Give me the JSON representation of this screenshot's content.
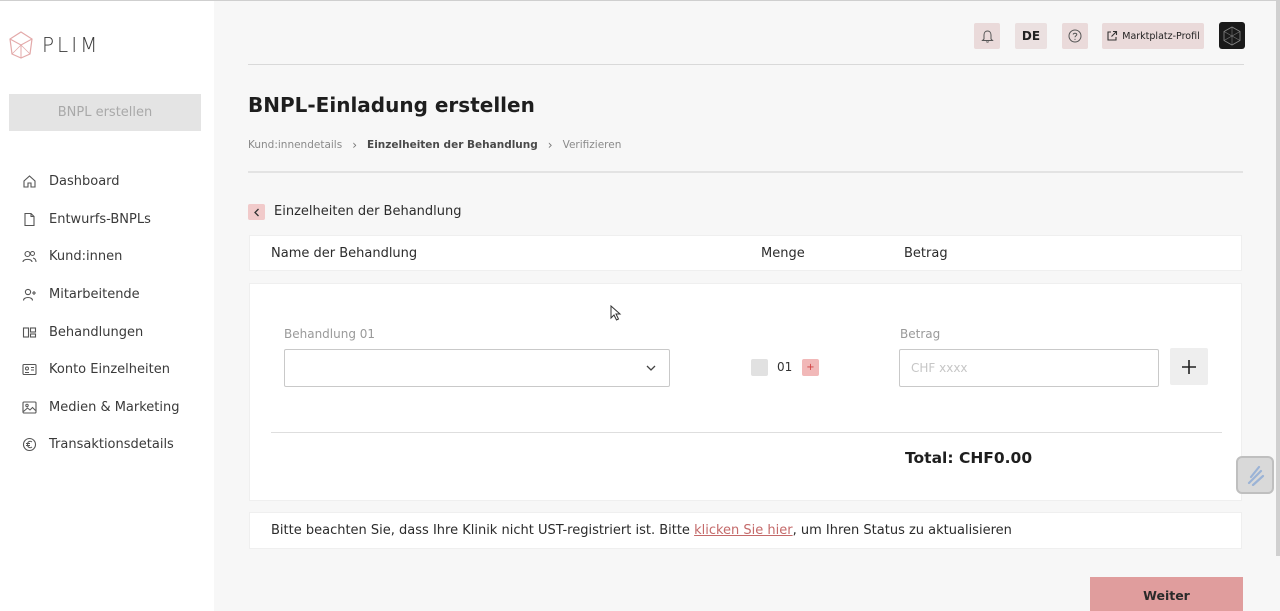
{
  "brand": {
    "name": "PLIM"
  },
  "sidebar": {
    "create_button": "BNPL erstellen",
    "items": [
      {
        "label": "Dashboard",
        "icon": "home-icon"
      },
      {
        "label": "Entwurfs-BNPLs",
        "icon": "document-icon"
      },
      {
        "label": "Kund:innen",
        "icon": "users-icon"
      },
      {
        "label": "Mitarbeitende",
        "icon": "user-plus-icon"
      },
      {
        "label": "Behandlungen",
        "icon": "treatments-icon"
      },
      {
        "label": "Konto Einzelheiten",
        "icon": "id-card-icon"
      },
      {
        "label": "Medien & Marketing",
        "icon": "image-icon"
      },
      {
        "label": "Transaktionsdetails",
        "icon": "euro-icon"
      }
    ]
  },
  "topbar": {
    "language": "DE",
    "marketplace_label": "Marktplatz-Profil"
  },
  "page": {
    "title": "BNPL-Einladung erstellen",
    "breadcrumb": [
      "Kund:innendetails",
      "Einzelheiten der Behandlung",
      "Verifizieren"
    ]
  },
  "section": {
    "title": "Einzelheiten der Behandlung",
    "columns": {
      "name": "Name der Behandlung",
      "quantity": "Menge",
      "amount": "Betrag"
    },
    "row": {
      "treatment_label": "Behandlung 01",
      "treatment_value": "",
      "quantity": "01",
      "plus": "+",
      "amount_label": "Betrag",
      "amount_placeholder": "CHF xxxx"
    },
    "total": "Total: CHF0.00"
  },
  "notice": {
    "before": "Bitte beachten Sie, dass Ihre Klinik nicht UST-registriert ist. Bitte ",
    "link": "klicken Sie hier",
    "after": ", um Ihren Status zu aktualisieren"
  },
  "actions": {
    "next": "Weiter"
  },
  "colors": {
    "accent": "#e09d9d",
    "accent_light": "#f1caca"
  }
}
